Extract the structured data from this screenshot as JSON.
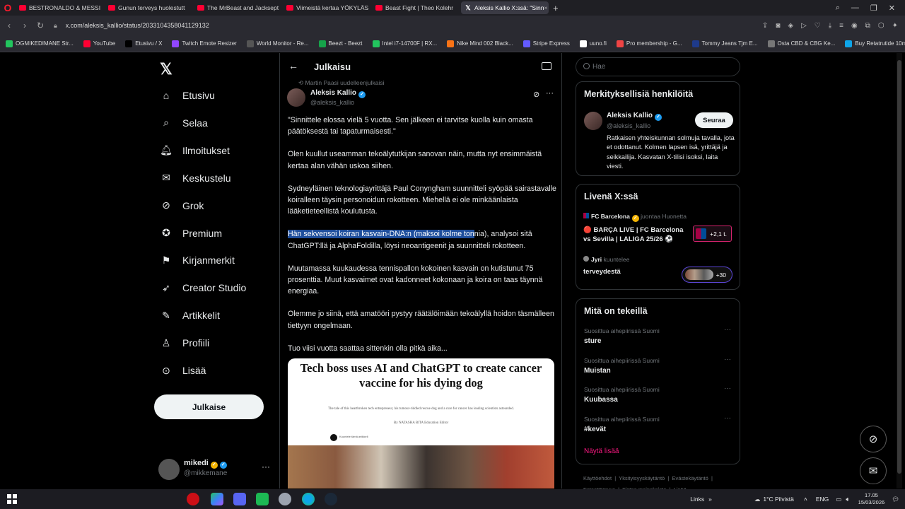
{
  "browser": {
    "tabs": [
      {
        "title": "BESTRONALDO & MESSI",
        "active": false,
        "icon": "youtube-icon"
      },
      {
        "title": "Gunun terveys huolestutt",
        "active": false,
        "icon": "youtube-icon"
      },
      {
        "title": "The MrBeast and Jacksept",
        "active": false,
        "icon": "youtube-icon"
      },
      {
        "title": "Viimeistä kertaa YÖKYLÄS",
        "active": false,
        "icon": "youtube-icon"
      },
      {
        "title": "Beast Fight | Theo Kolehr",
        "active": false,
        "icon": "youtube-icon"
      },
      {
        "title": "Aleksis Kallio X:ssä: \"Sinn",
        "active": true,
        "icon": "x-icon"
      }
    ],
    "url": "x.com/aleksis_kallio/status/2033104358041129132",
    "bookmarks": [
      {
        "label": "OGMIKEDIMANE Str...",
        "color": "#22c55e"
      },
      {
        "label": "YouTube",
        "color": "#ff0033"
      },
      {
        "label": "Etusivu / X",
        "color": "#000000"
      },
      {
        "label": "Twitch Emote Resizer",
        "color": "#9146ff"
      },
      {
        "label": "World Monitor - Re...",
        "color": "#555555"
      },
      {
        "label": "Beezt - Beezt",
        "color": "#16a34a"
      },
      {
        "label": "Intel i7-14700F | RX...",
        "color": "#22c55e"
      },
      {
        "label": "Nike Mind 002 Black...",
        "color": "#f97316"
      },
      {
        "label": "Stripe Express",
        "color": "#635bff"
      },
      {
        "label": "uuno.fi",
        "color": "#ffffff"
      },
      {
        "label": "Pro membership - G...",
        "color": "#ef4444"
      },
      {
        "label": "Tommy Jeans Tjm E...",
        "color": "#1e3a8a"
      },
      {
        "label": "Osta CBD & CBG Ke...",
        "color": "#777777"
      },
      {
        "label": "Buy Retatrutide 10m...",
        "color": "#0ea5e9"
      }
    ]
  },
  "nav": {
    "items": [
      {
        "label": "Etusivu",
        "icon": "home-icon"
      },
      {
        "label": "Selaa",
        "icon": "search-icon"
      },
      {
        "label": "Ilmoitukset",
        "icon": "bell-icon"
      },
      {
        "label": "Keskustelu",
        "icon": "mail-icon"
      },
      {
        "label": "Grok",
        "icon": "grok-icon"
      },
      {
        "label": "Premium",
        "icon": "premium-icon"
      },
      {
        "label": "Kirjanmerkit",
        "icon": "bookmark-icon"
      },
      {
        "label": "Creator Studio",
        "icon": "rocket-icon"
      },
      {
        "label": "Artikkelit",
        "icon": "article-icon"
      },
      {
        "label": "Profiili",
        "icon": "person-icon"
      },
      {
        "label": "Lisää",
        "icon": "more-circle-icon"
      }
    ],
    "post_button": "Julkaise",
    "account": {
      "name": "mikedi",
      "handle": "@mikkemane"
    }
  },
  "main": {
    "title": "Julkaisu",
    "reposted_by": "Martin Paasi uudelleenjulkaisi",
    "author": {
      "name": "Aleksis Kallio",
      "handle": "@aleksis_kallio"
    },
    "paragraphs": {
      "p1": "\"Sinnittele elossa vielä 5 vuotta. Sen jälkeen ei tarvitse kuolla kuin omasta päätöksestä tai tapaturmaisesti.\"",
      "p2": "Olen kuullut useamman tekoälytutkijan sanovan näin, mutta nyt ensimmäistä kertaa alan vähän uskoa siihen.",
      "p3": "Sydneyläinen teknologiayrittäjä Paul Conyngham suunnitteli syöpää sairastavalle koiralleen täysin personoidun rokotteen. Miehellä ei ole minkäänlaista lääketieteellistä koulutusta.",
      "p4_highlight": "Hän sekvensoi koiran kasvain-DNA:n (maksoi kolme ton",
      "p4_rest": "nia), analysoi sitä ChatGPT:llä ja AlphaFoldilla, löysi neoantigeenit ja suunnitteli rokotteen.",
      "p5": "Muutamassa kuukaudessa tennispallon kokoinen kasvain on kutistunut 75 prosenttia. Muut kasvaimet ovat kadonneet kokonaan ja koira on taas täynnä energiaa.",
      "p6": "Olemme jo siinä, että amatööri pystyy räätälöimään tekoälyllä hoidon täsmälleen tiettyyn ongelmaan.",
      "p7": "Tuo viisi vuotta saattaa sittenkin olla pitkä aika..."
    },
    "media": {
      "headline": "Tech boss uses AI and ChatGPT to create cancer vaccine for his dying dog",
      "subtitle": "The tale of this heartbroken tech entrepreneur, his tumour-riddled rescue dog and a cure for cancer has leading scientists astounded.",
      "byline": "By NATASHA BITA Education Editor",
      "listen": "Kuuntele tämä artikkeli"
    }
  },
  "sidebar": {
    "search_placeholder": "Hae",
    "who_to_follow": {
      "title": "Merkityksellisiä henkilöitä",
      "name": "Aleksis Kallio",
      "handle": "@aleksis_kallio",
      "follow": "Seuraa",
      "bio": "Ratkaisen yhteiskunnan solmuja tavalla, jota et odottanut. Kolmen lapsen isä, yrittäjä ja seikkailija. Kasvatan X-tilisi isoksi, laita viesti."
    },
    "live": {
      "title": "Livenä X:ssä",
      "item1_source": "FC Barcelona",
      "item1_sub": "juontaa Huonetta",
      "item1_title": "🔴 BARÇA LIVE | FC Barcelona vs Sevilla | LALIGA 25/26 ⚽",
      "item1_count": "+2,1 t.",
      "item2_source": "Jyri",
      "item2_sub": "kuuntelee",
      "item2_title": "terveydestä",
      "item2_count": "+30"
    },
    "trends": {
      "title": "Mitä on tekeillä",
      "items": [
        {
          "context": "Suosittua aihepiirissä Suomi",
          "name": "sture"
        },
        {
          "context": "Suosittua aihepiirissä Suomi",
          "name": "Muistan"
        },
        {
          "context": "Suosittua aihepiirissä Suomi",
          "name": "Kuubassa"
        },
        {
          "context": "Suosittua aihepiirissä Suomi",
          "name": "#kevät"
        }
      ],
      "show_more": "Näytä lisää"
    },
    "footer": [
      "Käyttöehdot",
      "Yksityisyyskäytäntö",
      "Evästekäytäntö",
      "Esteettömyys",
      "Tietoa mainoksista",
      "Lisää ..."
    ]
  },
  "taskbar": {
    "links": "Links",
    "weather": "1°C  Pilvistä",
    "lang": "ENG",
    "time": "17.05",
    "date": "15/03/2026"
  },
  "colors": {
    "accent_blue": "#1d9bf0",
    "highlight": "#1e4e9c",
    "show_more_pink": "#f91880"
  }
}
